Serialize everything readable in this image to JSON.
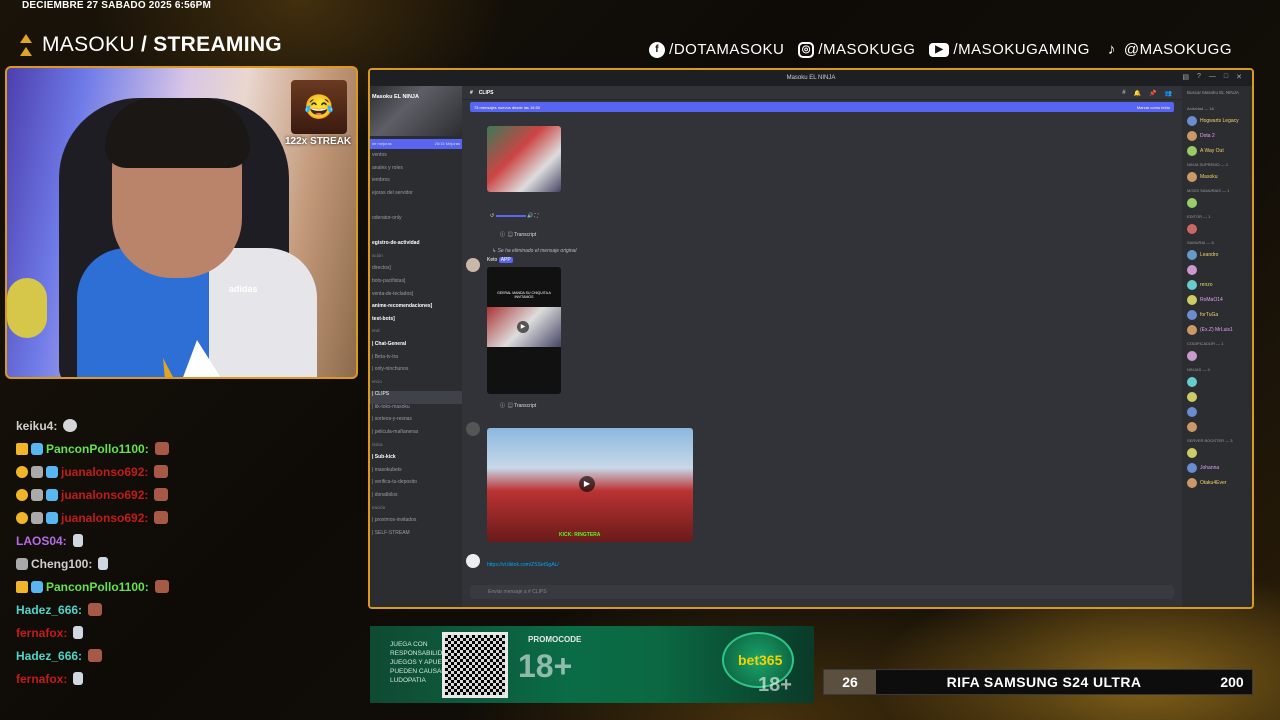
{
  "overlay": {
    "date_line": "DECIEMBRE 27 SABADO 2025 6:56PM",
    "brand_prefix": "MASOKU",
    "brand_slash": " / ",
    "brand_suffix": "STREAMING",
    "accent_color": "#d99a1e",
    "socials": [
      {
        "icon": "facebook-icon",
        "label": "/DOTAMASOKU"
      },
      {
        "icon": "instagram-icon",
        "label": "/MASOKUGG"
      },
      {
        "icon": "youtube-icon",
        "label": "/MASOKUGAMING"
      },
      {
        "icon": "tiktok-icon",
        "label": "@MASOKUGG"
      }
    ]
  },
  "webcam": {
    "streak_text": "122x STREAK",
    "shirt_logo": "adidas"
  },
  "chat": {
    "messages": [
      {
        "badges": [],
        "user": "keiku4:",
        "color": "#cfcfcf",
        "emote": "dog"
      },
      {
        "badges": [
          "crown",
          "gift"
        ],
        "user": "PanconPollo1100:",
        "color": "#66e24a",
        "emote": "face"
      },
      {
        "badges": [
          "one",
          "gray",
          "gift"
        ],
        "user": "juanalonso692:",
        "color": "#c21b1b",
        "emote": "face"
      },
      {
        "badges": [
          "one",
          "gray",
          "gift"
        ],
        "user": "juanalonso692:",
        "color": "#c21b1b",
        "emote": "face"
      },
      {
        "badges": [
          "one",
          "gray",
          "gift"
        ],
        "user": "juanalonso692:",
        "color": "#c21b1b",
        "emote": "face"
      },
      {
        "badges": [],
        "user": "LAOS04:",
        "color": "#b46ce6",
        "emote": "small"
      },
      {
        "badges": [
          "gray"
        ],
        "user": "Cheng100:",
        "color": "#cfcfcf",
        "emote": "small"
      },
      {
        "badges": [
          "crown",
          "gift"
        ],
        "user": "PanconPollo1100:",
        "color": "#66e24a",
        "emote": "face"
      },
      {
        "badges": [],
        "user": "Hadez_666:",
        "color": "#4fd4c8",
        "emote": "face"
      },
      {
        "badges": [],
        "user": "fernafox:",
        "color": "#c21b1b",
        "emote": "small"
      },
      {
        "badges": [],
        "user": "Hadez_666:",
        "color": "#4fd4c8",
        "emote": "face"
      },
      {
        "badges": [],
        "user": "fernafox:",
        "color": "#c21b1b",
        "emote": "small"
      }
    ]
  },
  "discord": {
    "window_title": "Masoku EL NINJA",
    "server_name": "Masoku EL NINJA",
    "boost_text": "de mejoras",
    "boost_count": "25/15 Mejoras",
    "channels": [
      {
        "name": "ventos",
        "style": ""
      },
      {
        "name": "anales y roles",
        "style": ""
      },
      {
        "name": "iembros",
        "style": ""
      },
      {
        "name": "ejoras del servidor",
        "style": ""
      },
      {
        "name": "",
        "style": "cat"
      },
      {
        "name": "oderator-only",
        "style": ""
      },
      {
        "name": "",
        "style": ""
      },
      {
        "name": "egistro-de-actividad",
        "style": "bold"
      },
      {
        "name": "ación",
        "style": "cat"
      },
      {
        "name": "directos]",
        "style": ""
      },
      {
        "name": "bots-pacifistas]",
        "style": ""
      },
      {
        "name": "venta-de-teclados]",
        "style": ""
      },
      {
        "name": "anime-recomendaciones]",
        "style": "bold"
      },
      {
        "name": "test-bots]",
        "style": "bold"
      },
      {
        "name": "eral",
        "style": "cat"
      },
      {
        "name": "| Chat-General",
        "style": "bold"
      },
      {
        "name": "| Beta-tv-tra",
        "style": ""
      },
      {
        "name": "| only-ninchunos",
        "style": ""
      },
      {
        "name": "ercio",
        "style": "cat"
      },
      {
        "name": "| CLIPS",
        "style": "active"
      },
      {
        "name": "| tik-toks-masoku",
        "style": ""
      },
      {
        "name": "| sorteos-y-resnas",
        "style": ""
      },
      {
        "name": "| pelicula-mañaneras",
        "style": ""
      },
      {
        "name": "ística",
        "style": "cat"
      },
      {
        "name": "| Sub-kick",
        "style": "bold"
      },
      {
        "name": "| masokubets",
        "style": ""
      },
      {
        "name": "| verifica-tu-deposito",
        "style": ""
      },
      {
        "name": "| donatbilos",
        "style": ""
      },
      {
        "name": "eación",
        "style": "cat"
      },
      {
        "name": "| proximos-invitados",
        "style": ""
      },
      {
        "name": "| SELF-STREAM",
        "style": ""
      }
    ],
    "channel_header": "CLIPS",
    "new_messages_bar": "75 mensajes nuevos desde las 16:50",
    "mark_read": "Marcar como leído",
    "deleted_notice": "Se ha eliminado el mensaje original",
    "msg2_author": "Keto",
    "msg2_tag": "APP",
    "clip1_caption": "GEERAL MANDA SU CHIQUITA A INVITAMOS",
    "clip2_overlay": "KICK: RINGTERA",
    "transcript_label": "Transcript",
    "link_text": "https://vt.tiktok.com/ZSSetSgAL/",
    "composer_placeholder": "Enviar mensaje a # CLIPS",
    "member_search": "Buscar Masoku EL NINJA",
    "members": [
      {
        "cat": "Actividad — 16",
        "items": [
          "Hogwarts Legacy",
          "Dota 2",
          "A Way Out"
        ]
      },
      {
        "cat": "NINJA SUPREMO — 1",
        "items": [
          "Masoku"
        ]
      },
      {
        "cat": "MODS SAMURAIS — 1",
        "items": [
          ""
        ]
      },
      {
        "cat": "EDITOR — 1",
        "items": [
          ""
        ]
      },
      {
        "cat": "SAMURAI — 6",
        "items": [
          "Leandro",
          "",
          "renzo",
          "RoMaO14",
          "forTuGa",
          "(Ex.Z) MrLuis1"
        ]
      },
      {
        "cat": "CODIFICADOR — 1",
        "items": [
          ""
        ]
      },
      {
        "cat": "NINJAS — 4",
        "items": [
          "",
          "",
          "",
          ""
        ]
      },
      {
        "cat": "SERVER BOOSTER — 3",
        "items": [
          "",
          "Johanna",
          "Otaku4Ever"
        ]
      }
    ]
  },
  "ad": {
    "line1": "JUEGA CON RESPONSABILIDAD",
    "line2": "JUEGOS Y APUESTAS PUEDEN CAUSAR LUDOPATIA",
    "promo_label": "PROMOCODE",
    "age_badge": "18+",
    "brand": "bet365",
    "age_badge2": "18+"
  },
  "raffle": {
    "left_number": "26",
    "title": "RIFA SAMSUNG S24 ULTRA",
    "right_number": "200"
  }
}
